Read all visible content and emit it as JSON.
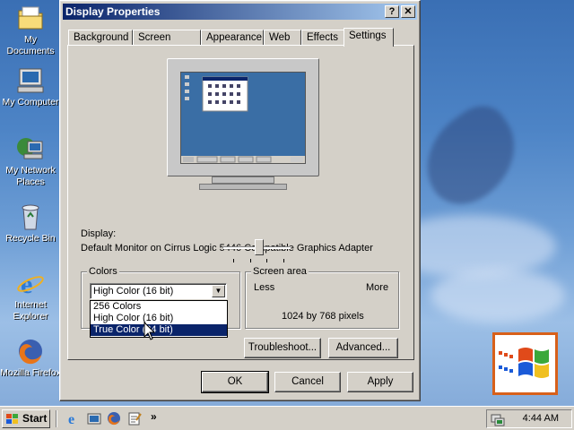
{
  "desktop": {
    "icons": [
      {
        "label": "My Documents",
        "icon": "folder-icon"
      },
      {
        "label": "My Computer",
        "icon": "computer-icon"
      },
      {
        "label": "My Network Places",
        "icon": "network-icon"
      },
      {
        "label": "Recycle Bin",
        "icon": "recycle-bin-icon"
      },
      {
        "label": "Internet Explorer",
        "icon": "ie-icon"
      },
      {
        "label": "Mozilla Firefox",
        "icon": "firefox-icon"
      }
    ]
  },
  "window": {
    "title": "Display Properties",
    "help_button": "?",
    "close_button": "✕",
    "tabs": [
      "Background",
      "Screen Saver",
      "Appearance",
      "Web",
      "Effects",
      "Settings"
    ],
    "active_tab": "Settings",
    "display_label": "Display:",
    "display_value": "Default Monitor on Cirrus Logic 5446 Compatible Graphics Adapter",
    "colors": {
      "group_title": "Colors",
      "selected": "High Color (16 bit)",
      "options": [
        "256 Colors",
        "High Color (16 bit)",
        "True Color (24 bit)"
      ],
      "highlighted": "True Color (24 bit)"
    },
    "screen_area": {
      "group_title": "Screen area",
      "less_label": "Less",
      "more_label": "More",
      "resolution": "1024 by 768 pixels"
    },
    "buttons": {
      "troubleshoot": "Troubleshoot...",
      "advanced": "Advanced...",
      "ok": "OK",
      "cancel": "Cancel",
      "apply": "Apply"
    }
  },
  "taskbar": {
    "start_label": "Start",
    "chevron": "»",
    "clock": "4:44 AM"
  },
  "colors": {
    "title_active": "#0a246a",
    "face": "#d4d0c8",
    "selection": "#0a246a"
  }
}
